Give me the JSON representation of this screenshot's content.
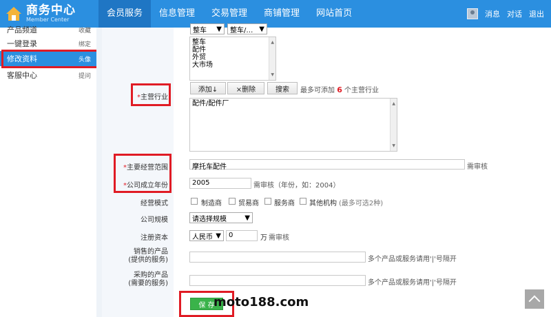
{
  "header": {
    "title": "商务中心",
    "subtitle": "Member Center",
    "tabs": [
      {
        "label": "会员服务"
      },
      {
        "label": "信息管理"
      },
      {
        "label": "交易管理"
      },
      {
        "label": "商铺管理"
      },
      {
        "label": "网站首页"
      }
    ],
    "right": {
      "messages": "消息",
      "chat": "对话",
      "logout": "退出"
    }
  },
  "sidebar": {
    "items": [
      {
        "label": "产品频道",
        "sub": "收藏"
      },
      {
        "label": "一键登录",
        "sub": "绑定"
      },
      {
        "label": "修改资料",
        "sub": "头像"
      },
      {
        "label": "客服中心",
        "sub": "提问"
      }
    ]
  },
  "form": {
    "top_selects": [
      "整车",
      "整车/…"
    ],
    "industry_options": [
      "整车",
      "配件",
      "外贸",
      "大市场"
    ],
    "industry_label": "主营行业",
    "btn_add": "添加↓",
    "btn_delete": "×删除",
    "btn_search": "搜索",
    "industry_hint_pre": "最多可添加",
    "industry_hint_num": "6",
    "industry_hint_post": "个主营行业",
    "selected_industry": "配件/配件厂",
    "scope_label": "主要经营范围",
    "scope_value": "摩托车配件",
    "scope_hint": "需审核",
    "year_label": "公司成立年份",
    "year_value": "2005",
    "year_hint": "需审核（年份，如：2004）",
    "mode_label": "经营模式",
    "mode_options": [
      "制造商",
      "贸易商",
      "服务商",
      "其他机构"
    ],
    "mode_hint": "(最多可选2种)",
    "size_label": "公司规模",
    "size_value": "请选择规模",
    "capital_label": "注册资本",
    "currency_value": "人民币",
    "capital_value": "0",
    "capital_unit": "万",
    "capital_hint": "需审核",
    "sell_label_1": "销售的产品",
    "sell_label_2": "(提供的服务)",
    "sell_hint": "多个产品或服务请用'|'号隔开",
    "buy_label_1": "采购的产品",
    "buy_label_2": "(需要的服务)",
    "buy_hint": "多个产品或服务请用'|'号隔开",
    "save": "保 存"
  },
  "watermark": "moto188.com",
  "colors": {
    "nav": "#2b8fe0",
    "nav_active": "#1f76c4",
    "highlight": "#e01b24",
    "save": "#3ab34a"
  }
}
